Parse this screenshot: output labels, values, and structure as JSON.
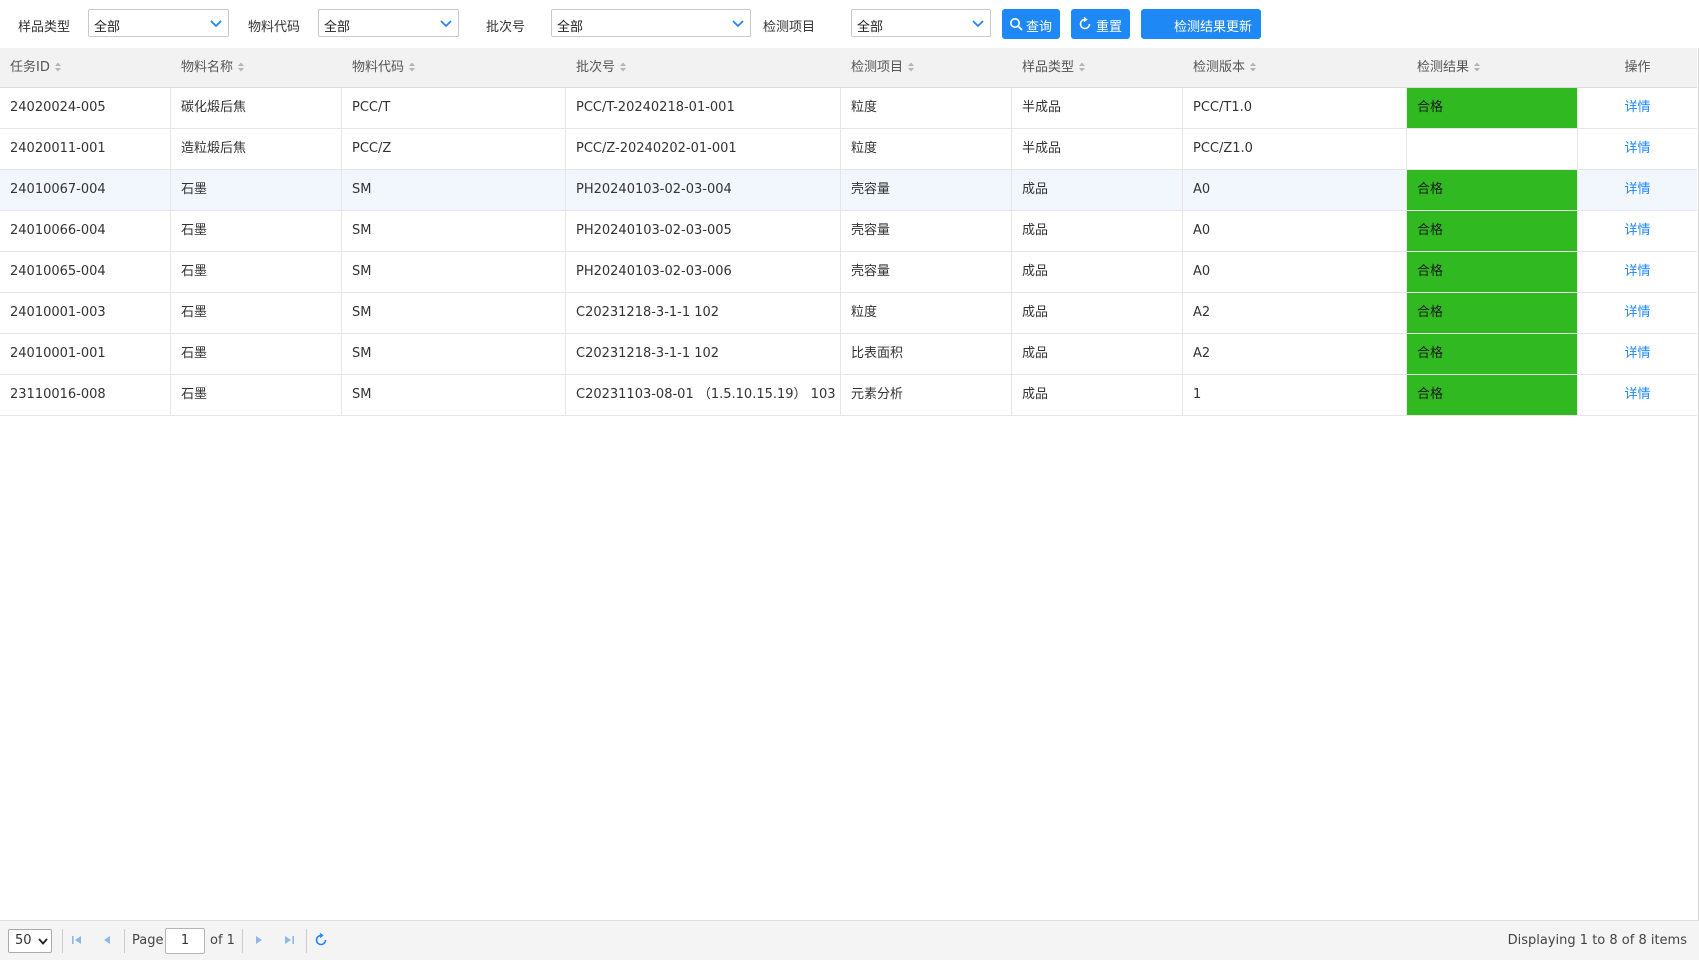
{
  "filters": {
    "sample_type": {
      "label": "样品类型",
      "value": "全部"
    },
    "material_code": {
      "label": "物料代码",
      "value": "全部"
    },
    "batch_no": {
      "label": "批次号",
      "value": "全部"
    },
    "test_item": {
      "label": "检测项目",
      "value": "全部"
    }
  },
  "buttons": {
    "query": "查询",
    "reset": "重置",
    "update": "检测结果更新"
  },
  "colors": {
    "primary": "#1e88f5",
    "pass": "#31b922",
    "row_highlight": "#f2f7fd"
  },
  "table": {
    "columns": [
      "任务ID",
      "物料名称",
      "物料代码",
      "批次号",
      "检测项目",
      "样品类型",
      "检测版本",
      "检测结果",
      "操作"
    ],
    "rows": [
      {
        "id": "24020024-005",
        "name": "碳化煅后焦",
        "code": "PCC/T",
        "batch": "PCC/T-20240218-01-001",
        "item": "粒度",
        "type": "半成品",
        "version": "PCC/T1.0",
        "result": "合格",
        "action": "详情"
      },
      {
        "id": "24020011-001",
        "name": "造粒煅后焦",
        "code": "PCC/Z",
        "batch": "PCC/Z-20240202-01-001",
        "item": "粒度",
        "type": "半成品",
        "version": "PCC/Z1.0",
        "result": "",
        "action": "详情"
      },
      {
        "id": "24010067-004",
        "name": "石墨",
        "code": "SM",
        "batch": "PH20240103-02-03-004",
        "item": "壳容量",
        "type": "成品",
        "version": "A0",
        "result": "合格",
        "action": "详情"
      },
      {
        "id": "24010066-004",
        "name": "石墨",
        "code": "SM",
        "batch": "PH20240103-02-03-005",
        "item": "壳容量",
        "type": "成品",
        "version": "A0",
        "result": "合格",
        "action": "详情"
      },
      {
        "id": "24010065-004",
        "name": "石墨",
        "code": "SM",
        "batch": "PH20240103-02-03-006",
        "item": "壳容量",
        "type": "成品",
        "version": "A0",
        "result": "合格",
        "action": "详情"
      },
      {
        "id": "24010001-003",
        "name": "石墨",
        "code": "SM",
        "batch": "C20231218-3-1-1 102",
        "item": "粒度",
        "type": "成品",
        "version": "A2",
        "result": "合格",
        "action": "详情"
      },
      {
        "id": "24010001-001",
        "name": "石墨",
        "code": "SM",
        "batch": "C20231218-3-1-1 102",
        "item": "比表面积",
        "type": "成品",
        "version": "A2",
        "result": "合格",
        "action": "详情"
      },
      {
        "id": "23110016-008",
        "name": "石墨",
        "code": "SM",
        "batch": "C20231103-08-01 （1.5.10.15.19） 103",
        "item": "元素分析",
        "type": "成品",
        "version": "1",
        "result": "合格",
        "action": "详情"
      }
    ]
  },
  "pager": {
    "page_size": "50",
    "page_label": "Page",
    "page_value": "1",
    "of_label": "of 1",
    "info": "Displaying 1 to 8 of 8 items"
  }
}
